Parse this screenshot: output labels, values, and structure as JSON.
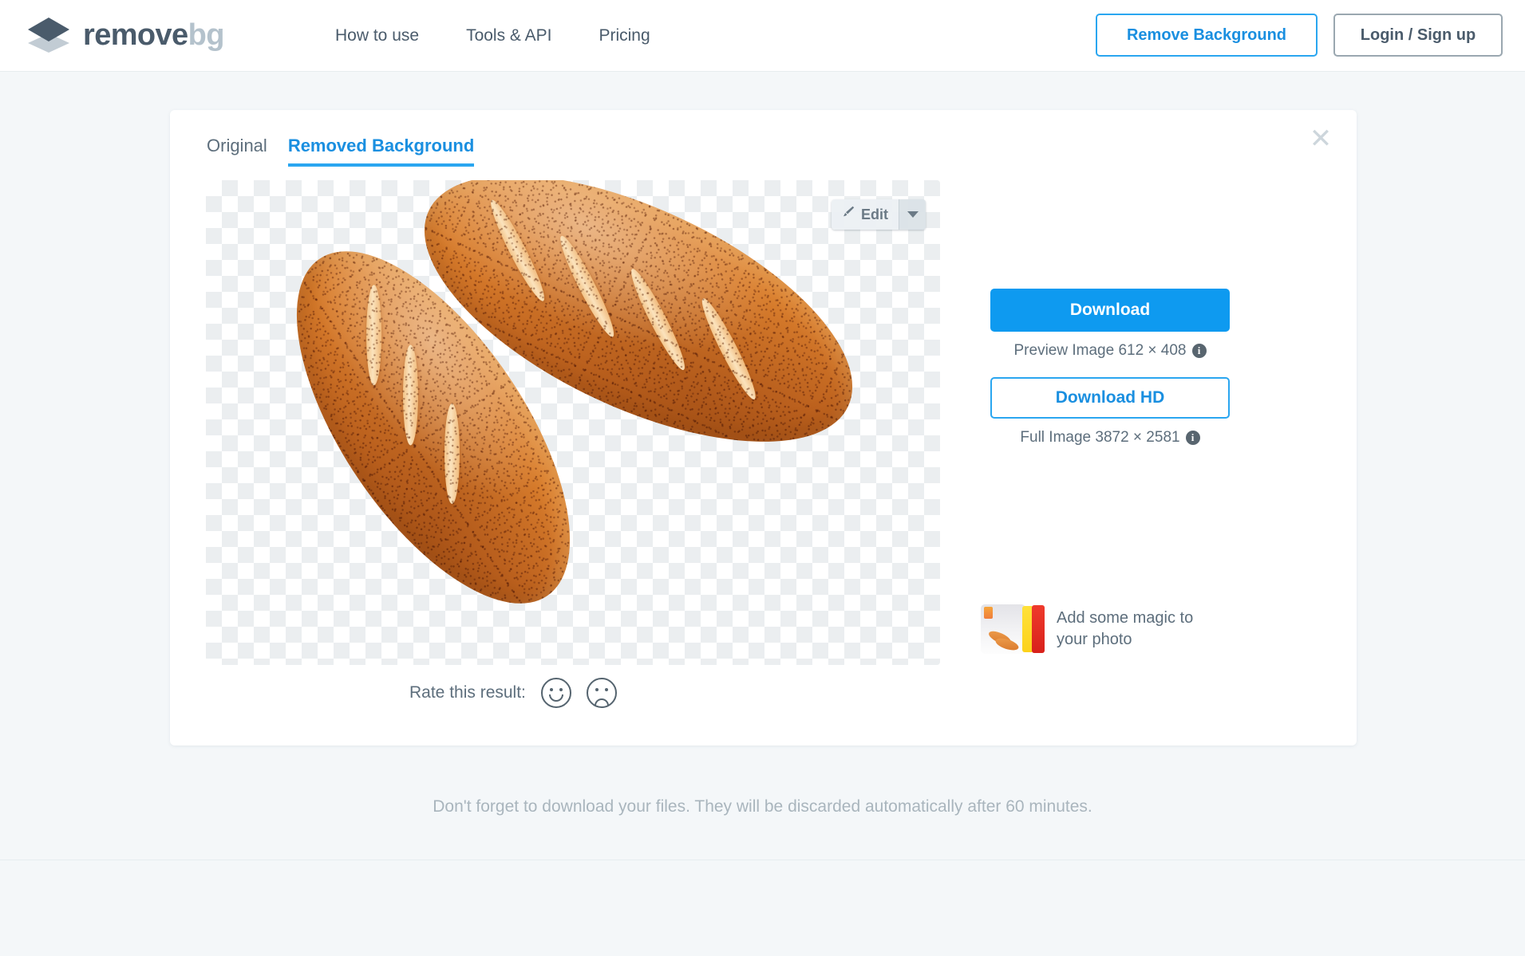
{
  "header": {
    "logo": {
      "primary": "remove",
      "secondary": "bg",
      "icon": "stacked-layers-icon"
    },
    "nav": [
      {
        "label": "How to use"
      },
      {
        "label": "Tools & API"
      },
      {
        "label": "Pricing"
      }
    ],
    "remove_background_button": "Remove Background",
    "login_button": "Login / Sign up",
    "accent_color": "#2aa6f0",
    "text_color": "#4a5b6b"
  },
  "card": {
    "close_label": "✕",
    "tabs": [
      {
        "label": "Original",
        "active": false
      },
      {
        "label": "Removed Background",
        "active": true
      }
    ],
    "edit": {
      "label": "Edit",
      "icon": "paintbrush-icon",
      "caret_icon": "chevron-down-icon"
    },
    "rate": {
      "label": "Rate this result:",
      "positive_icon": "smiley-face-icon",
      "negative_icon": "frowny-face-icon"
    }
  },
  "download": {
    "primary_label": "Download",
    "primary_note": "Preview Image 612 × 408",
    "secondary_label": "Download HD",
    "secondary_note": "Full Image 3872 × 2581",
    "info_icon": "i",
    "primary_color": "#0e9af0"
  },
  "promo": {
    "text": "Add some magic to your photo",
    "thumbnail_icon": "photo-effects-thumbnail"
  },
  "footer": {
    "discard_note": "Don't forget to download your files. They will be discarded automatically after 60 minutes."
  }
}
